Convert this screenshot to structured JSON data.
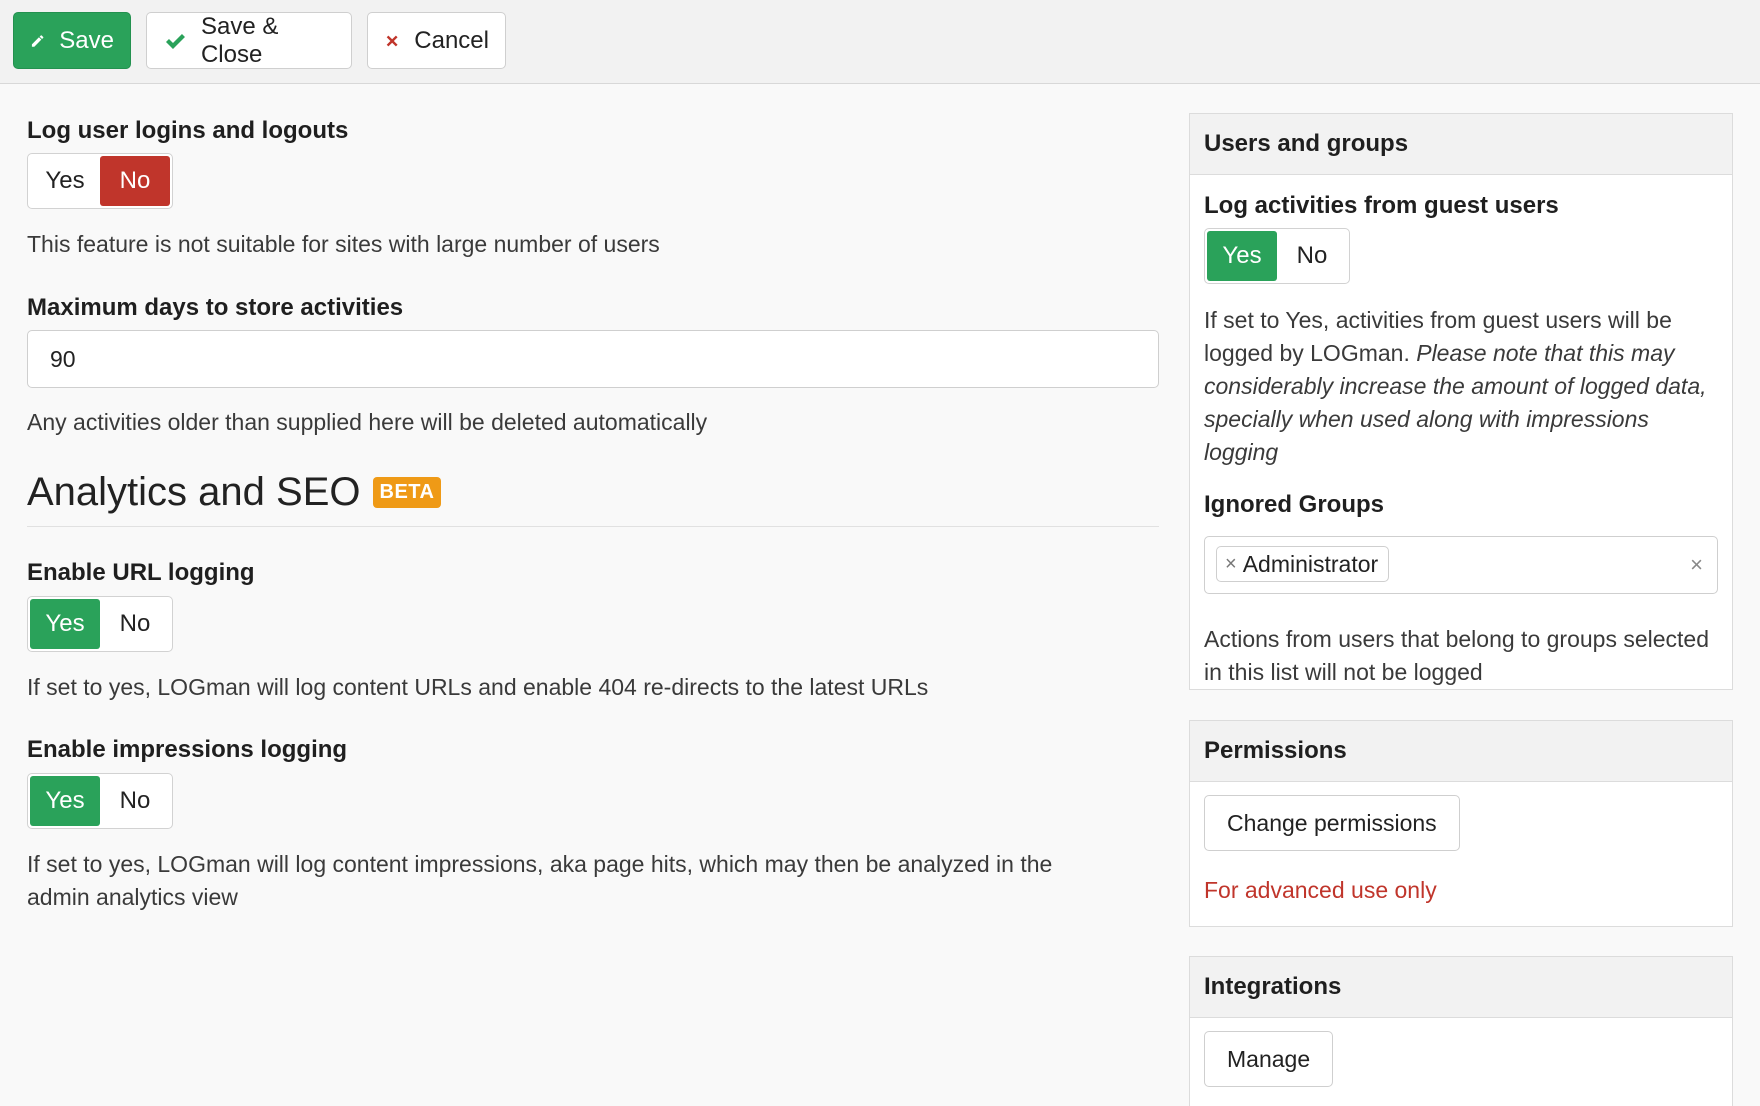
{
  "toolbar": {
    "save_label": "Save",
    "save_close_label": "Save & Close",
    "cancel_label": "Cancel"
  },
  "main": {
    "log_logins": {
      "label": "Log user logins and logouts",
      "yes": "Yes",
      "no": "No",
      "selected": "No",
      "help": "This feature is not suitable for sites with large number of users"
    },
    "max_days": {
      "label": "Maximum days to store activities",
      "value": "90",
      "help": "Any activities older than supplied here will be deleted automatically"
    },
    "analytics_section": {
      "title": "Analytics and SEO",
      "badge": "BETA"
    },
    "url_logging": {
      "label": "Enable URL logging",
      "yes": "Yes",
      "no": "No",
      "selected": "Yes",
      "help": "If set to yes, LOGman will log content URLs and enable 404 re-directs to the latest URLs"
    },
    "impressions_logging": {
      "label": "Enable impressions logging",
      "yes": "Yes",
      "no": "No",
      "selected": "Yes",
      "help_line1": "If set to yes, LOGman will log content impressions, aka page hits, which may then be analyzed in the",
      "help_line2": "admin analytics view"
    }
  },
  "sidebar": {
    "users_groups": {
      "title": "Users and groups",
      "guest_label": "Log activities from guest users",
      "yes": "Yes",
      "no": "No",
      "selected": "Yes",
      "guest_help_plain": "If set to Yes, activities from guest users will be logged by LOGman.",
      "guest_help_italic": "Please note that this may considerably increase the amount of logged data, specially when used along with impressions logging",
      "ignored_label": "Ignored Groups",
      "ignored_chip": "Administrator",
      "chip_remove": "×",
      "clear_all": "×",
      "ignored_help": "Actions from users that belong to groups selected in this list will not be logged"
    },
    "permissions": {
      "title": "Permissions",
      "button": "Change permissions",
      "warning": "For advanced use only"
    },
    "integrations": {
      "title": "Integrations",
      "button": "Manage"
    }
  },
  "colors": {
    "success": "#2aa25a",
    "danger": "#c0352b",
    "beta": "#ef9a16"
  },
  "icons": {
    "save": "pencil-icon",
    "save_close": "check-icon",
    "cancel": "cross-icon"
  }
}
